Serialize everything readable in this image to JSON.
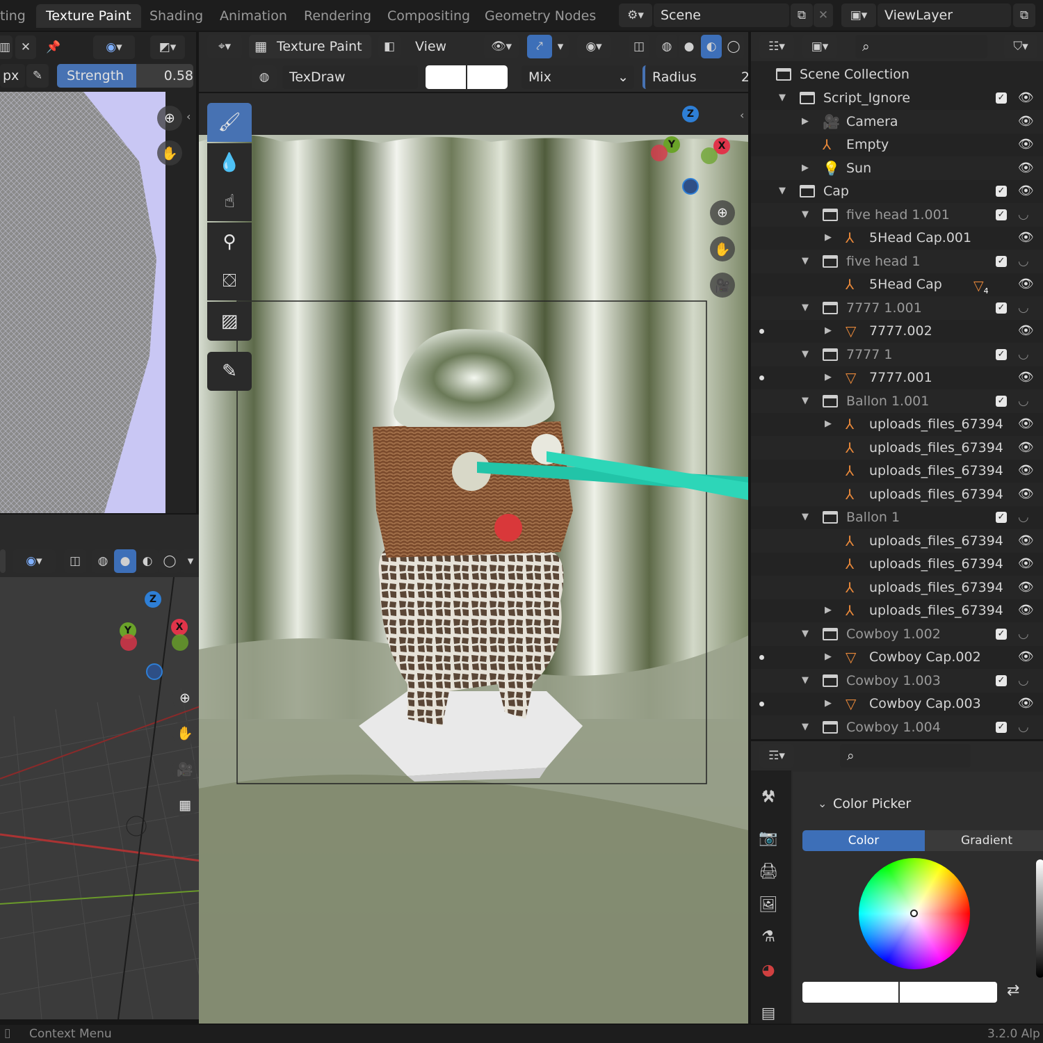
{
  "workspace_tabs": [
    "ting",
    "Texture Paint",
    "Shading",
    "Animation",
    "Rendering",
    "Compositing",
    "Geometry Nodes"
  ],
  "scene": {
    "label": "Scene",
    "view_layer": "ViewLayer"
  },
  "image_editor": {
    "unit": "px",
    "strength_label": "Strength",
    "strength_value": "0.58"
  },
  "viewport_header": {
    "mode": "Texture Paint",
    "view": "View",
    "brush": "TexDraw",
    "blend": "Mix",
    "radius": "Radius",
    "radius_value": "2"
  },
  "outliner": {
    "root": "Scene Collection",
    "rows": [
      {
        "label": "Script_Ignore",
        "kind": "collection",
        "level": 0,
        "checked": true,
        "eye": true,
        "expanded": true
      },
      {
        "label": "Camera",
        "kind": "camera",
        "level": 1,
        "eye": true
      },
      {
        "label": "Empty",
        "kind": "empty",
        "level": 1,
        "eye": true
      },
      {
        "label": "Sun",
        "kind": "light",
        "level": 1,
        "eye": true
      },
      {
        "label": "Cap",
        "kind": "collection",
        "level": 0,
        "checked": true,
        "eye": true,
        "expanded": true
      },
      {
        "label": "five head 1.001",
        "kind": "collection",
        "level": 1,
        "checked": true,
        "eye": false,
        "expanded": true
      },
      {
        "label": "5Head Cap.001",
        "kind": "empty",
        "level": 2,
        "eye": true
      },
      {
        "label": "five head 1",
        "kind": "collection",
        "level": 1,
        "checked": true,
        "eye": false,
        "expanded": true
      },
      {
        "label": "5Head Cap",
        "kind": "empty",
        "level": 2,
        "eye": true,
        "badge": "4"
      },
      {
        "label": "7777 1.001",
        "kind": "collection",
        "level": 1,
        "checked": true,
        "eye": false,
        "expanded": true
      },
      {
        "label": "7777.002",
        "kind": "mesh",
        "level": 2,
        "eye": true,
        "dot": true
      },
      {
        "label": "7777 1",
        "kind": "collection",
        "level": 1,
        "checked": true,
        "eye": false,
        "expanded": true
      },
      {
        "label": "7777.001",
        "kind": "mesh",
        "level": 2,
        "eye": true,
        "dot": true
      },
      {
        "label": "Ballon 1.001",
        "kind": "collection",
        "level": 1,
        "checked": true,
        "eye": false,
        "expanded": true
      },
      {
        "label": "uploads_files_67394",
        "kind": "empty",
        "level": 2,
        "eye": true
      },
      {
        "label": "uploads_files_67394",
        "kind": "empty",
        "level": 2,
        "eye": true
      },
      {
        "label": "uploads_files_67394",
        "kind": "empty",
        "level": 2,
        "eye": true
      },
      {
        "label": "uploads_files_67394",
        "kind": "empty",
        "level": 2,
        "eye": true
      },
      {
        "label": "Ballon 1",
        "kind": "collection",
        "level": 1,
        "checked": true,
        "eye": false,
        "expanded": true
      },
      {
        "label": "uploads_files_67394",
        "kind": "empty",
        "level": 2,
        "eye": true
      },
      {
        "label": "uploads_files_67394",
        "kind": "empty",
        "level": 2,
        "eye": true
      },
      {
        "label": "uploads_files_67394",
        "kind": "empty",
        "level": 2,
        "eye": true
      },
      {
        "label": "uploads_files_67394",
        "kind": "empty",
        "level": 2,
        "eye": true
      },
      {
        "label": "Cowboy 1.002",
        "kind": "collection",
        "level": 1,
        "checked": true,
        "eye": false,
        "expanded": true
      },
      {
        "label": "Cowboy Cap.002",
        "kind": "mesh",
        "level": 2,
        "eye": true,
        "dot": true
      },
      {
        "label": "Cowboy 1.003",
        "kind": "collection",
        "level": 1,
        "checked": true,
        "eye": false,
        "expanded": true
      },
      {
        "label": "Cowboy Cap.003",
        "kind": "mesh",
        "level": 2,
        "eye": true,
        "dot": true
      },
      {
        "label": "Cowboy 1.004",
        "kind": "collection",
        "level": 1,
        "checked": true,
        "eye": false,
        "expanded": true
      }
    ]
  },
  "properties": {
    "section": "Color Picker",
    "tabs": [
      "Color",
      "Gradient"
    ]
  },
  "gizmo": {
    "x": "X",
    "y": "Y",
    "z": "Z"
  },
  "status": {
    "left": "Context Menu",
    "right": "3.2.0 Alp"
  },
  "colors": {
    "accent": "#4772b3",
    "bg": "#161616",
    "panel": "#232323"
  }
}
